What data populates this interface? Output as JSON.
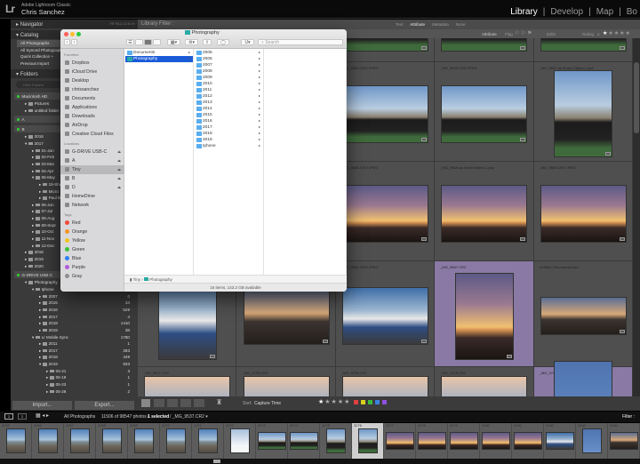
{
  "app": {
    "name": "Adobe Lightroom Classic",
    "user": "Chris Sanchez",
    "logo": "Lr",
    "modules": [
      "Library",
      "Develop",
      "Map",
      "Bo"
    ],
    "active_module": "Library"
  },
  "left": {
    "navigator": "Navigator",
    "nav_zoom": "FIT  FILL  1:1  3:1 ▾",
    "catalog": "Catalog",
    "catalog_items": [
      "All Photographs",
      "All Synced Photographs",
      "Quick Collection +",
      "Previous Import"
    ],
    "folders": "Folders",
    "folder_search_placeholder": "Filter Folders",
    "volumes": [
      {
        "name": "Macintosh HD",
        "children": [
          {
            "label": "Pictures",
            "depth": 1,
            "exp": false
          },
          {
            "label": "untitled folder",
            "depth": 1,
            "exp": false
          }
        ]
      },
      {
        "name": "A",
        "children": []
      },
      {
        "name": "B",
        "children": [
          {
            "label": "2016",
            "depth": 1,
            "exp": false
          },
          {
            "label": "2017",
            "depth": 1,
            "exp": true
          },
          {
            "label": "01-Jan",
            "depth": 2
          },
          {
            "label": "02-Feb",
            "depth": 2
          },
          {
            "label": "03-Mar",
            "depth": 2
          },
          {
            "label": "04-Apr",
            "depth": 2
          },
          {
            "label": "05-May",
            "depth": 2,
            "exp": true
          },
          {
            "label": "19-Sha",
            "depth": 3
          },
          {
            "label": "Micro",
            "depth": 3
          },
          {
            "label": "Paul B",
            "depth": 3
          },
          {
            "label": "06-Jun",
            "depth": 2
          },
          {
            "label": "07-Jul",
            "depth": 2
          },
          {
            "label": "08-Aug",
            "depth": 2
          },
          {
            "label": "09-Sept",
            "depth": 2
          },
          {
            "label": "10-Oct",
            "depth": 2
          },
          {
            "label": "11-Nov",
            "depth": 2
          },
          {
            "label": "12-Dec",
            "depth": 2
          },
          {
            "label": "2018",
            "depth": 1
          },
          {
            "label": "2019",
            "depth": 1
          },
          {
            "label": "2020",
            "depth": 1
          }
        ]
      },
      {
        "name": "G-DRIVE USB-C",
        "children": [
          {
            "label": "Photography",
            "depth": 1,
            "exp": true
          },
          {
            "label": "Iphone",
            "depth": 2,
            "exp": true
          },
          {
            "label": "2007",
            "depth": 3,
            "count": "0"
          },
          {
            "label": "2015",
            "depth": 3,
            "count": "33"
          },
          {
            "label": "2016",
            "depth": 3,
            "count": "529"
          },
          {
            "label": "2017",
            "depth": 3,
            "count": "4"
          },
          {
            "label": "2018",
            "depth": 3,
            "count": "1410"
          },
          {
            "label": "2019",
            "depth": 3,
            "count": "38"
          },
          {
            "label": "Lr Mobile Sync",
            "depth": 2,
            "exp": true,
            "count": "1780"
          },
          {
            "label": "2011",
            "depth": 3,
            "count": "1"
          },
          {
            "label": "2017",
            "depth": 3,
            "count": "393"
          },
          {
            "label": "2018",
            "depth": 3,
            "count": "449"
          },
          {
            "label": "2019",
            "depth": 3,
            "exp": true,
            "count": "933"
          },
          {
            "label": "04-21",
            "depth": 4,
            "count": "3"
          },
          {
            "label": "05-19",
            "depth": 4,
            "count": "1"
          },
          {
            "label": "05-23",
            "depth": 4,
            "count": "1"
          },
          {
            "label": "05-26",
            "depth": 4,
            "count": "2"
          }
        ]
      }
    ],
    "import": "Import...",
    "export": "Export..."
  },
  "filter": {
    "title": "Library Filter :",
    "tabs": [
      "Text",
      "Attribute",
      "Metadata",
      "None"
    ],
    "active": "Attribute",
    "attr_label": "Attribute",
    "flag": "Flag",
    "edits": "Edits",
    "rating": "Rating",
    "rating_op": "≥"
  },
  "grid": {
    "rows": [
      [
        {
          "label": "",
          "t": "man"
        },
        {
          "label": "",
          "t": "man"
        },
        {
          "label": "",
          "t": "man"
        },
        {
          "label": "",
          "t": "man"
        },
        {
          "label": "",
          "t": "man"
        }
      ],
      [
        {
          "label": "_MG_9530.CR2+JPEG",
          "t": "man"
        },
        {
          "label": "_MG_9531.CR2+JPEG",
          "t": "man"
        },
        {
          "label": "_MG_9532.CR2+JPEG",
          "t": "man"
        },
        {
          "label": "_MG_9533.CR2+JPEG",
          "t": "man"
        },
        {
          "label": "_MG_9537 as Smart Object-1.psd",
          "t": "man",
          "portrait": true
        }
      ],
      [
        {
          "label": "",
          "t": "sunset"
        },
        {
          "label": "",
          "t": "sunset"
        },
        {
          "label": "_MG_9668.CR2+JPEG",
          "t": "sunset"
        },
        {
          "label": "_MG_9669 as Smart Object-1.psd",
          "t": "sunset"
        },
        {
          "label": "_MG_9669.CR2+JPEG",
          "t": "sunset"
        }
      ],
      [
        {
          "label": "",
          "t": "boats",
          "portrait": true
        },
        {
          "label": "",
          "t": "pier"
        },
        {
          "label": "_MG_9681.CR2+JPEG",
          "t": "boats"
        },
        {
          "label": "_MG_9687.CR2",
          "t": "sunset",
          "portrait": true,
          "sel": true
        },
        {
          "label": "Untitled_Panorama2.psd",
          "t": "pier",
          "pano": true
        }
      ],
      [
        {
          "label": "_MG_9697.CR2",
          "t": "sky"
        },
        {
          "label": "_MG_9705.CR2",
          "t": "sky"
        },
        {
          "label": "_MG_9706.CR2",
          "t": "sky"
        },
        {
          "label": "_MG_9718.CR2",
          "t": "sky"
        },
        {
          "label": "_MG_9741.CR2",
          "t": "blue",
          "portrait": true,
          "sel": true
        }
      ]
    ]
  },
  "toolbar": {
    "sort_label": "Sort:",
    "sort_value": "Capture Time",
    "label_colors": [
      "#e04040",
      "#d8d020",
      "#3cb83c",
      "#3c80e0",
      "#9050e0"
    ]
  },
  "status": {
    "source": "All Photographs",
    "count": "11506 of 98547 photos /",
    "selected": "1 selected",
    "file": "/ _MG_9537.CR2 ▾",
    "filter": "Filter :",
    "pages": [
      "1",
      "2"
    ]
  },
  "filmstrip": {
    "numbers": [
      "3265",
      "3266",
      "3267",
      "3268",
      "3269",
      "3270",
      "3271",
      "3272",
      "3273",
      "3274",
      "3275",
      "3276",
      "3277",
      "3278",
      "3279",
      "3280",
      "3281",
      "3282",
      "3283",
      "3284"
    ],
    "types": [
      "beach",
      "beach",
      "beach",
      "beach",
      "beach",
      "beach",
      "beach",
      "white",
      "man",
      "man",
      "man",
      "man",
      "sunset",
      "sunset",
      "sunset",
      "sunset",
      "sunset",
      "boats",
      "blue",
      "pier"
    ],
    "selected_index": 11
  },
  "finder": {
    "title": "Photography",
    "search_placeholder": "Search",
    "favorites_label": "Favorites",
    "favorites": [
      "Dropbox",
      "iCloud Drive",
      "Desktop",
      "chrissanchez",
      "Documents",
      "Applications",
      "Downloads",
      "AirDrop",
      "Creative Cloud Files"
    ],
    "locations_label": "Locations",
    "locations": [
      "G-DRIVE USB-C",
      "A",
      "Tiny",
      "B",
      "D",
      "HomeDrive",
      "Network"
    ],
    "selected_location": "Tiny",
    "tags_label": "Tags",
    "tags": [
      {
        "name": "Red",
        "color": "#f04a3e"
      },
      {
        "name": "Orange",
        "color": "#f5962a"
      },
      {
        "name": "Yellow",
        "color": "#f2c522"
      },
      {
        "name": "Green",
        "color": "#3dc13c"
      },
      {
        "name": "Blue",
        "color": "#2f7ff0"
      },
      {
        "name": "Purple",
        "color": "#b45bd8"
      },
      {
        "name": "Gray",
        "color": "#8e8e8e"
      }
    ],
    "col1": [
      "Documents",
      "Photography"
    ],
    "col1_selected": "Photography",
    "col2": [
      "2005",
      "2006",
      "2007",
      "2008",
      "2009",
      "2010",
      "2011",
      "2012",
      "2013",
      "2014",
      "2015",
      "2016",
      "2017",
      "2018",
      "2019",
      "Iphone"
    ],
    "path": [
      "Tiny",
      "Photography"
    ],
    "status": "16 items, 143.2 GB available"
  }
}
